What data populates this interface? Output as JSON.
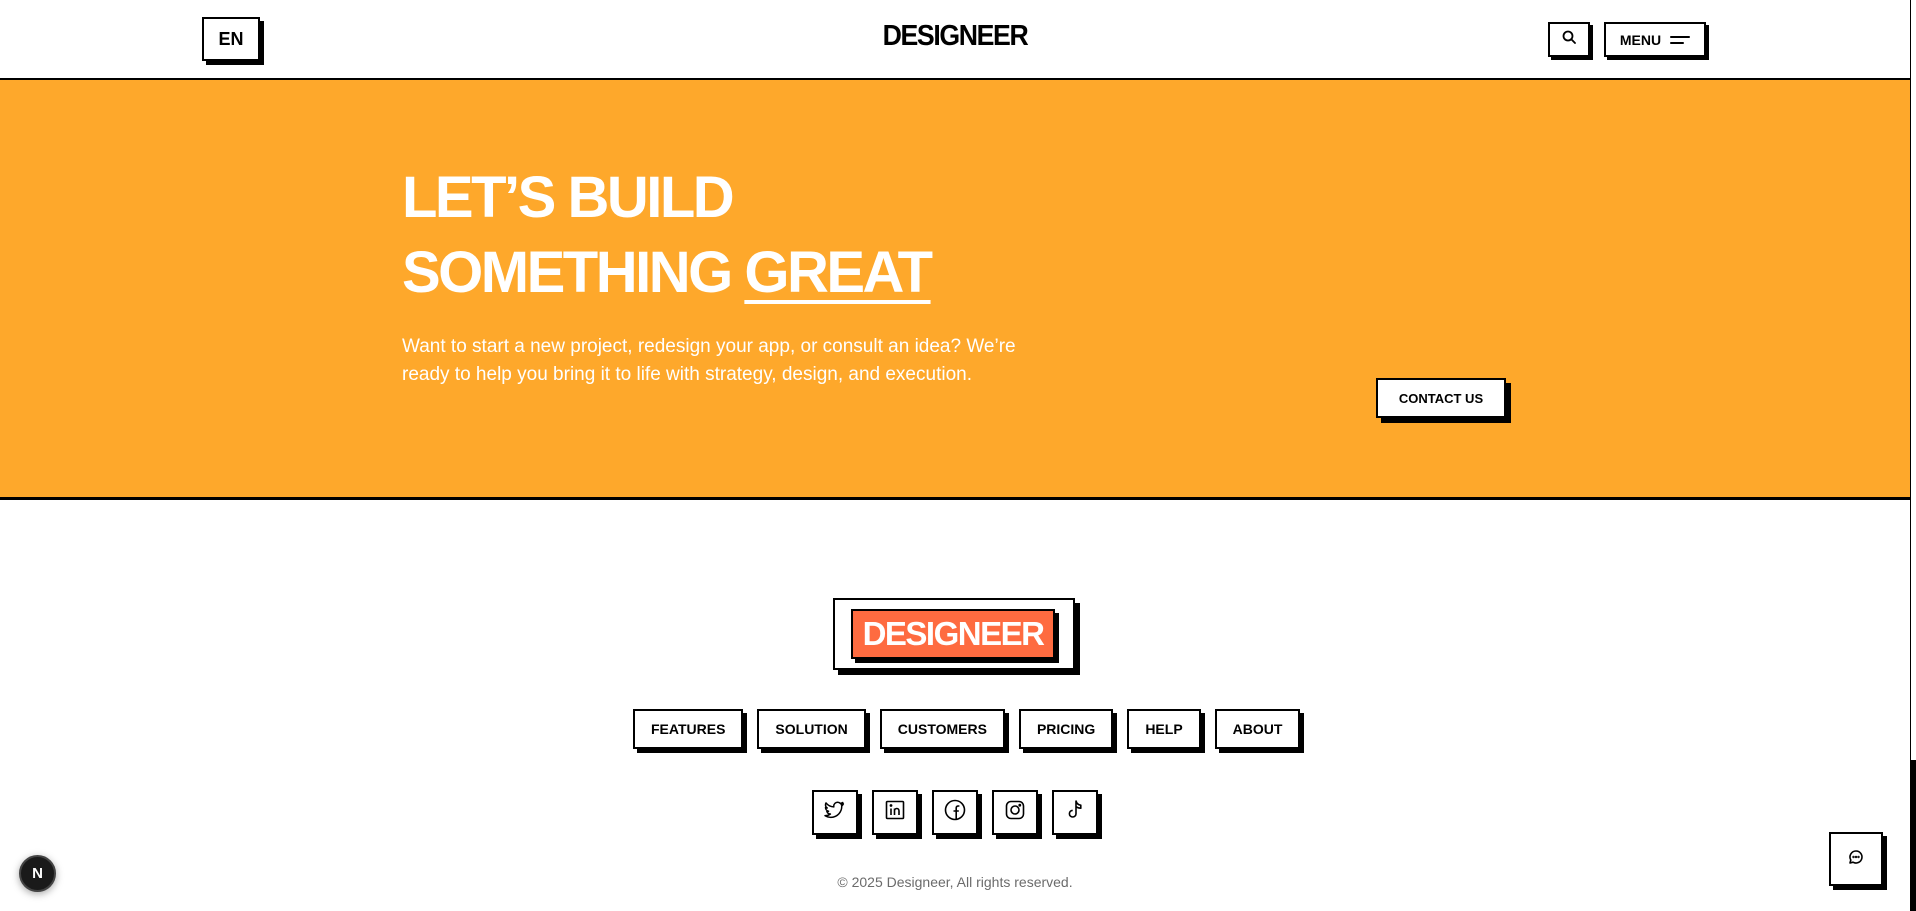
{
  "header": {
    "language": "EN",
    "logo": "DESIGNEER",
    "menu_label": "MENU",
    "search_icon": "search-icon",
    "menu_icon": "hamburger-icon"
  },
  "hero": {
    "title_line1": "LET’S BUILD",
    "title_line2_prefix": "SOMETHING",
    "title_line2_highlight": "GREAT",
    "description": "Want to start a new project, redesign your app, or consult an idea? We’re ready to help you bring it to life with strategy, design, and execution.",
    "cta_label": "CONTACT US",
    "background_color": "#fea82b"
  },
  "footer": {
    "logo": "DESIGNEER",
    "logo_color": "#fe6b40",
    "nav": [
      {
        "label": "FEATURES"
      },
      {
        "label": "SOLUTION"
      },
      {
        "label": "CUSTOMERS"
      },
      {
        "label": "PRICING"
      },
      {
        "label": "HELP"
      },
      {
        "label": "ABOUT"
      }
    ],
    "social": [
      "twitter-icon",
      "linkedin-icon",
      "facebook-icon",
      "instagram-icon",
      "tiktok-icon"
    ],
    "copyright": "© 2025 Designeer, All rights reserved."
  },
  "widgets": {
    "framework_badge": "N",
    "chat_icon": "chat-icon"
  }
}
